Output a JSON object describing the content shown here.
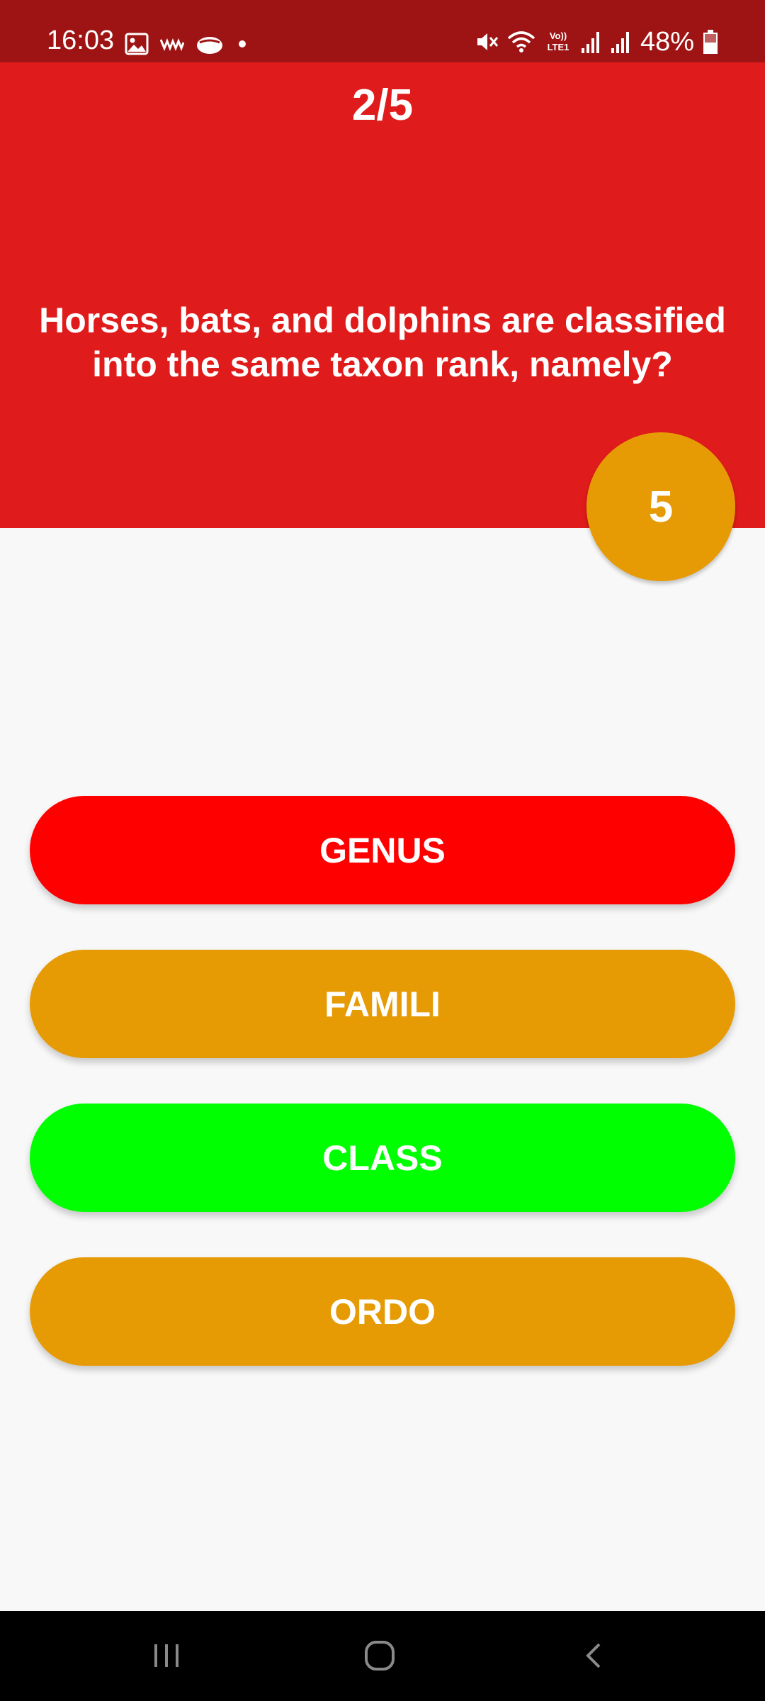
{
  "status_bar": {
    "time": "16:03",
    "battery_text": "48%",
    "left_icons": [
      "gallery-icon",
      "wave-icon",
      "cloud-icon",
      "dot-icon"
    ],
    "right_icons": [
      "mute-icon",
      "wifi-icon",
      "volte-icon",
      "signal-icon",
      "signal-icon",
      "battery-icon"
    ],
    "volte_label_top": "Vo))",
    "volte_label_bottom": "LTE1"
  },
  "quiz": {
    "progress": "2/5",
    "question": "Horses, bats, and dolphins are classified into the same taxon rank, namely?",
    "timer": "5",
    "answers": [
      {
        "label": "GENUS",
        "color": "#ff0000"
      },
      {
        "label": "FAMILI",
        "color": "#e69b05"
      },
      {
        "label": "CLASS",
        "color": "#00ff00"
      },
      {
        "label": "ORDO",
        "color": "#e69b05"
      }
    ]
  },
  "colors": {
    "status_bar": "#9e1414",
    "header": "#e01b1b",
    "background": "#f8f8f8",
    "timer": "#e69b05",
    "nav_bar": "#000000"
  },
  "nav_bar": {
    "icons": [
      "recent-apps-icon",
      "home-icon",
      "back-icon"
    ]
  }
}
